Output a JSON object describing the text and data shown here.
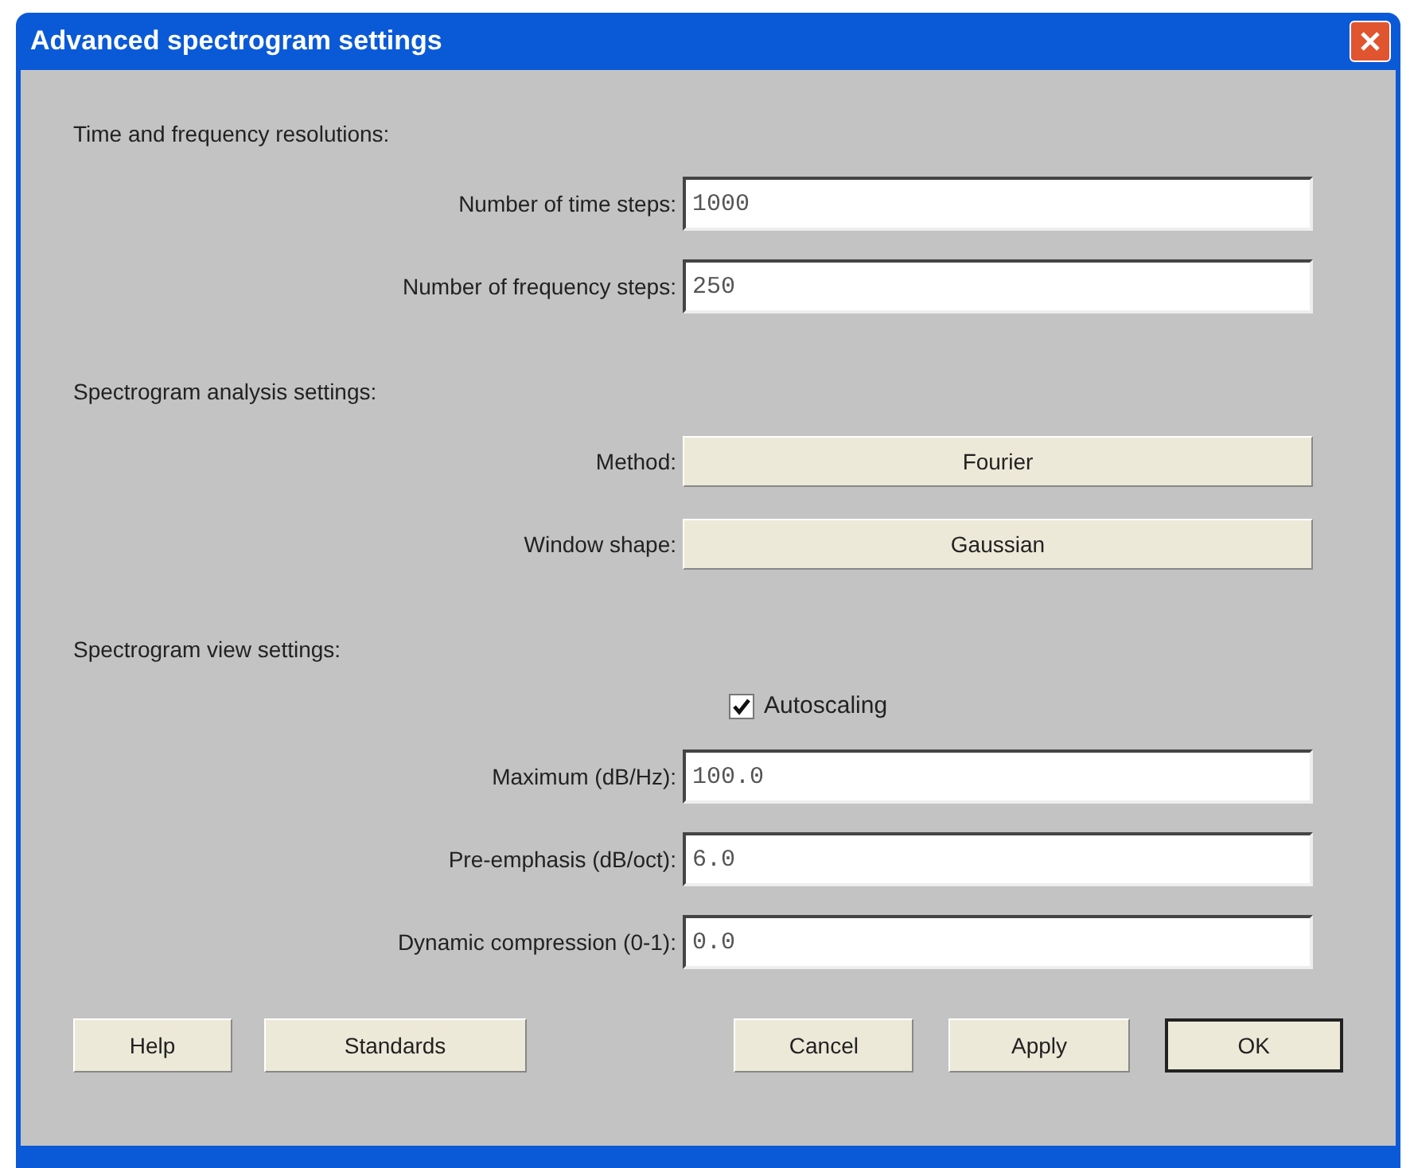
{
  "window": {
    "title": "Advanced spectrogram settings"
  },
  "rows": [
    {
      "kind": "heading",
      "label": "Time and frequency resolutions:"
    },
    {
      "kind": "field",
      "label": "Number of time steps:",
      "value": "1000"
    },
    {
      "kind": "field",
      "label": "Number of frequency steps:",
      "value": "250"
    },
    {
      "kind": "heading",
      "label": "Spectrogram analysis settings:"
    },
    {
      "kind": "choice",
      "label": "Method:",
      "value": "Fourier"
    },
    {
      "kind": "choice",
      "label": "Window shape:",
      "value": "Gaussian"
    },
    {
      "kind": "heading",
      "label": "Spectrogram view settings:"
    },
    {
      "kind": "checkbox",
      "label": "Autoscaling",
      "checked": true
    },
    {
      "kind": "field",
      "label": "Maximum (dB/Hz):",
      "value": "100.0"
    },
    {
      "kind": "field",
      "label": "Pre-emphasis (dB/oct):",
      "value": "6.0"
    },
    {
      "kind": "field",
      "label": "Dynamic compression (0-1):",
      "value": "0.0"
    }
  ],
  "buttons": [
    {
      "label": "Help",
      "default": false
    },
    {
      "label": "Standards",
      "default": false
    },
    {
      "label": "Cancel",
      "default": false
    },
    {
      "label": "Apply",
      "default": false
    },
    {
      "label": "OK",
      "default": true
    }
  ]
}
